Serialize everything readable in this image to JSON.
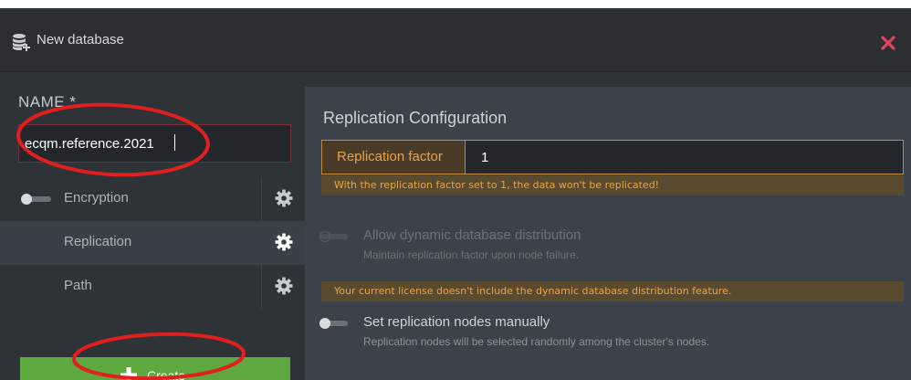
{
  "dialog": {
    "title": "New database",
    "icon": "database-add-icon",
    "close_icon": "close-icon",
    "close_color": "#e2455b"
  },
  "name": {
    "label": "NAME *",
    "value": "ecqm.reference.2021"
  },
  "options": [
    {
      "label": "Encryption",
      "toggle_on": false,
      "active": false,
      "icon": "gear-icon"
    },
    {
      "label": "Replication",
      "active": true,
      "icon": "gear-icon"
    },
    {
      "label": "Path",
      "active": false,
      "icon": "gear-icon"
    }
  ],
  "create_button": {
    "label": "Create",
    "icon": "plus-icon",
    "color": "#5fa83f"
  },
  "replication": {
    "section_title": "Replication Configuration",
    "factor_label": "Replication factor",
    "factor_value": "1",
    "factor_warning": "With the replication factor set to 1, the data won't be replicated!",
    "dynamic_distribution": {
      "title": "Allow dynamic database distribution",
      "subtitle": "Maintain replication factor upon node failure.",
      "enabled": false,
      "disabled": true
    },
    "license_warning": "Your current license doesn't include the dynamic database distribution feature.",
    "manual_nodes": {
      "title": "Set replication nodes manually",
      "subtitle": "Replication nodes will be selected randomly among the cluster's nodes.",
      "enabled": false
    }
  },
  "colors": {
    "warning_text": "#e6a646",
    "warning_bg": "#5a4a30",
    "accent_border": "#c5893c",
    "annotation_red": "#e0201e"
  }
}
